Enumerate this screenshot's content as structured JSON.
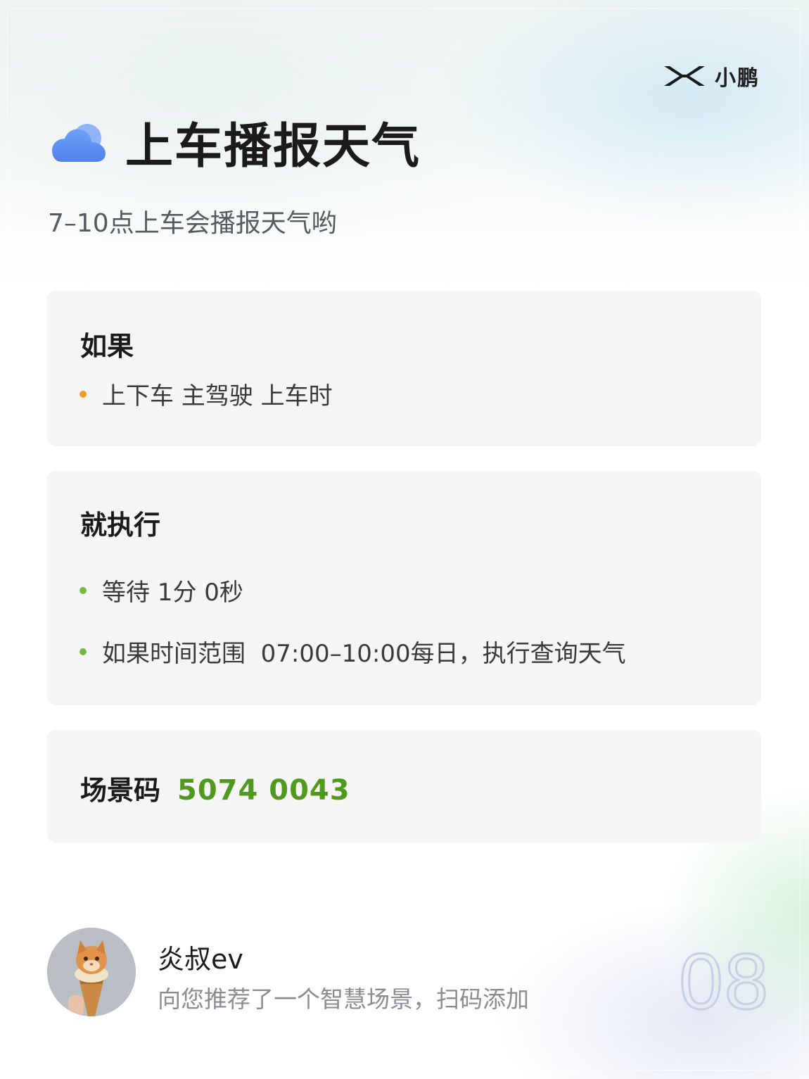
{
  "brand": {
    "name": "小鹏"
  },
  "header": {
    "title": "上车播报天气",
    "subtitle": "7–10点上车会播报天气哟"
  },
  "condition": {
    "heading": "如果",
    "items": [
      "上下车 主驾驶 上车时"
    ]
  },
  "action": {
    "heading": "就执行",
    "items": [
      "等待 1分 0秒",
      "如果时间范围  07:00–10:00每日，执行查询天气"
    ]
  },
  "scene_code": {
    "label": "场景码",
    "value": "5074 0043"
  },
  "footer": {
    "author": "炎叔ev",
    "message": "向您推荐了一个智慧场景，扫码添加",
    "page_number": "08"
  },
  "colors": {
    "accent_green": "#4f9a1c",
    "bullet_orange": "#f39a2c",
    "bullet_green": "#76b83f",
    "cloud_blue": "#5b8ff0"
  },
  "icons": {
    "weather": "cloud-icon",
    "brand": "xpeng-logo-icon",
    "avatar": "cat-ice-cream-avatar"
  }
}
